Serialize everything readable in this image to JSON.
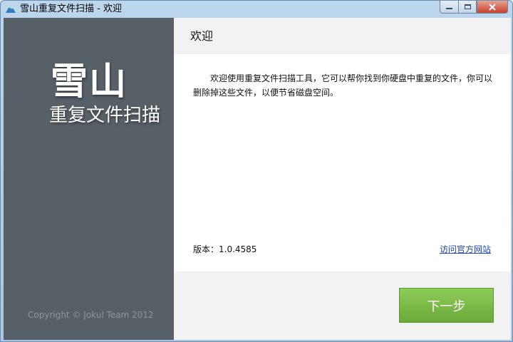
{
  "window": {
    "title": "雪山重复文件扫描 - 欢迎",
    "app_icon": "snow-mountain-icon"
  },
  "controls": {
    "minimize_icon": "minimize-icon",
    "maximize_icon": "maximize-icon",
    "close_icon": "close-icon"
  },
  "sidebar": {
    "logo_main": "雪山",
    "logo_sub": "重复文件扫描",
    "copyright": "Copyright © Jokul Team 2012"
  },
  "main": {
    "header_title": "欢迎",
    "intro_text": "欢迎使用重复文件扫描工具，它可以帮你找到你硬盘中重复的文件，你可以删除掉这些文件，以便节省磁盘空间。",
    "version_label": "版本：1.0.4585",
    "site_link": "访问官方网站"
  },
  "footer": {
    "next_label": "下一步"
  },
  "colors": {
    "sidebar_bg": "#575f67",
    "next_button": "#7cbd48",
    "link": "#1f47b8"
  }
}
